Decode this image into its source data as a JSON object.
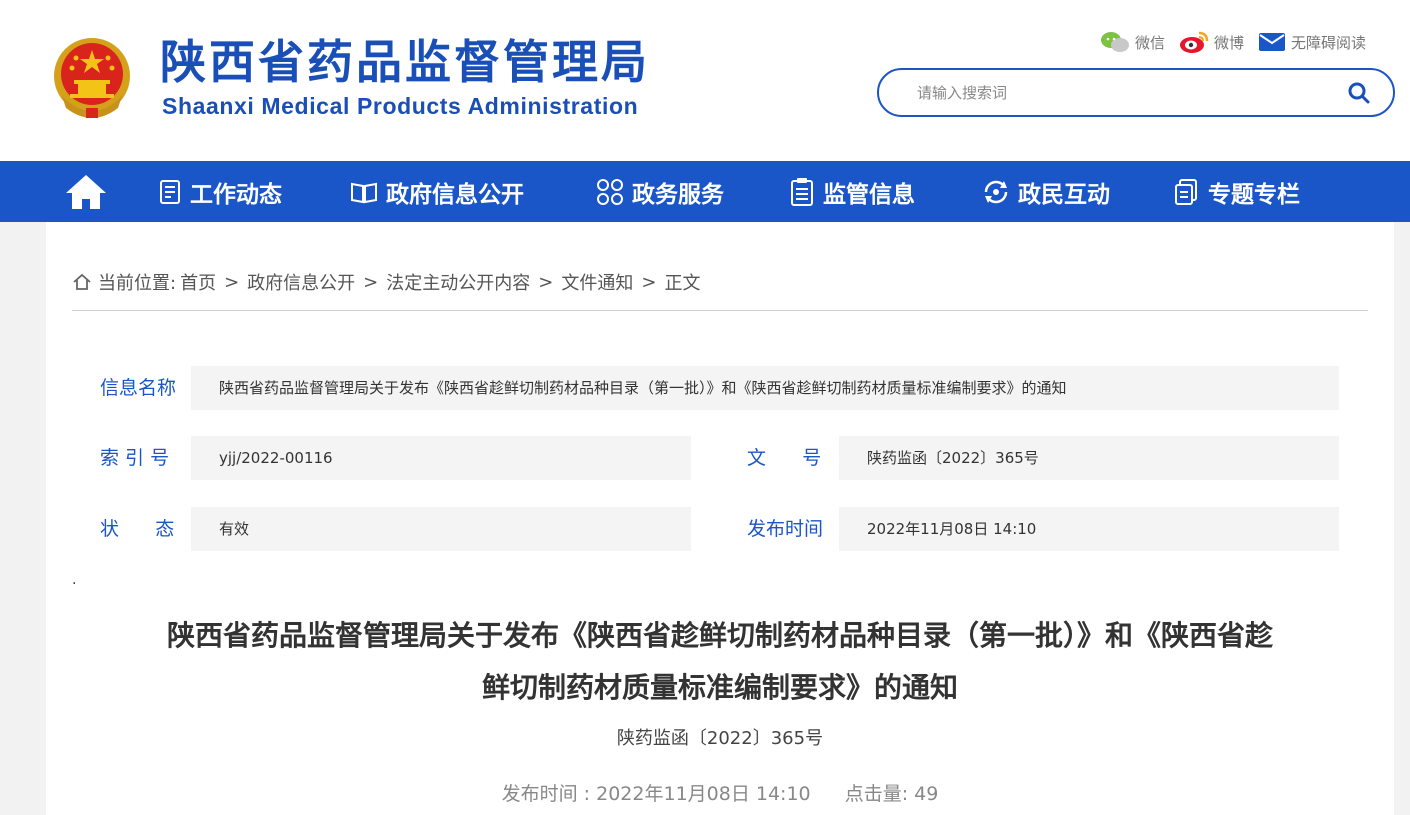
{
  "header": {
    "title_cn": "陕西省药品监督管理局",
    "title_en": "Shaanxi Medical Products Administration",
    "emblem_icon": "national-emblem-icon",
    "top_links": [
      {
        "label": "微信",
        "icon": "wechat-icon"
      },
      {
        "label": "微博",
        "icon": "weibo-icon"
      },
      {
        "label": "无障碍阅读",
        "icon": "mail-icon"
      }
    ],
    "search": {
      "placeholder": "请输入搜索词",
      "value": ""
    }
  },
  "nav": {
    "home_icon": "home-icon",
    "items": [
      {
        "label": "工作动态",
        "icon": "document-list-icon"
      },
      {
        "label": "政府信息公开",
        "icon": "open-book-icon"
      },
      {
        "label": "政务服务",
        "icon": "grid-circles-icon"
      },
      {
        "label": "监管信息",
        "icon": "clipboard-icon"
      },
      {
        "label": "政民互动",
        "icon": "interaction-icon"
      },
      {
        "label": "专题专栏",
        "icon": "folder-doc-icon"
      }
    ]
  },
  "breadcrumb": {
    "prefix": "当前位置:",
    "items": [
      "首页",
      "政府信息公开",
      "法定主动公开内容",
      "文件通知",
      "正文"
    ]
  },
  "meta": {
    "info_name_label": "信息名称",
    "info_name_value": "陕西省药品监督管理局关于发布《陕西省趁鲜切制药材品种目录（第一批）》和《陕西省趁鲜切制药材质量标准编制要求》的通知",
    "index_label": "索 引 号",
    "index_value": "yjj/2022-00116",
    "docnum_label": "文      号",
    "docnum_value": "陕药监函〔2022〕365号",
    "status_label": "状      态",
    "status_value": "有效",
    "pubtime_label": "发布时间",
    "pubtime_value": "2022年11月08日 14:10"
  },
  "article": {
    "dot": ".",
    "title_line1": "陕西省药品监督管理局关于发布《陕西省趁鲜切制药材品种目录（第一批）》和《陕西省趁",
    "title_line2": "鲜切制药材质量标准编制要求》的通知",
    "doc_number": "陕药监函〔2022〕365号",
    "publish_time_label": "发布时间 : 2022年11月08日 14:10",
    "hits_label": "点击量:",
    "hits_value": "49"
  },
  "colors": {
    "brand_blue": "#1a56c8",
    "nav_text": "#ffffff",
    "panel_bg": "#ffffff",
    "page_bg": "#f2f2f2"
  }
}
